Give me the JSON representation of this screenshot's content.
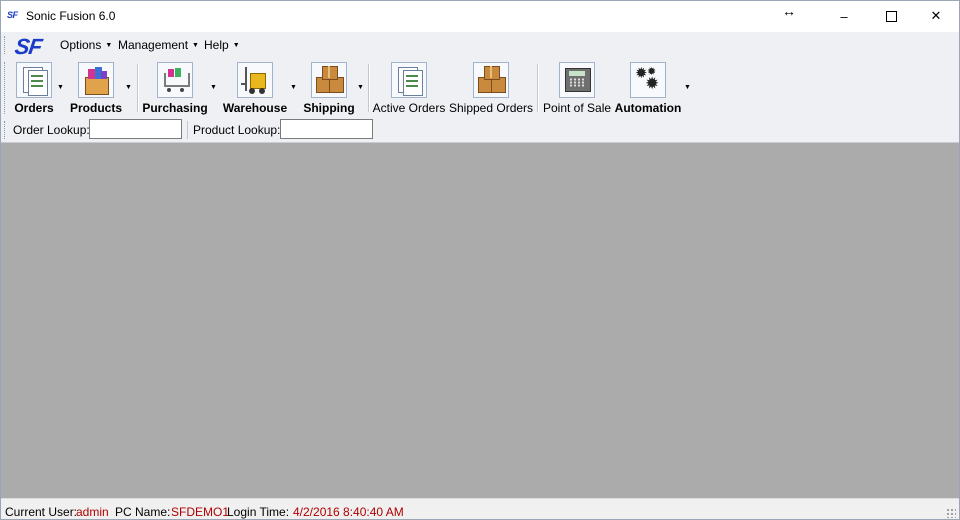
{
  "window": {
    "small_logo": "SF",
    "title": "Sonic Fusion 6.0",
    "controls": {
      "minimize": "–",
      "maximize": "",
      "close": "✕",
      "resize_hint": "↔"
    }
  },
  "menubar": {
    "logo": "SF",
    "items": [
      {
        "label": "Options",
        "caret": "▼"
      },
      {
        "label": "Management",
        "caret": "▼"
      },
      {
        "label": "Help",
        "caret": "▼"
      }
    ]
  },
  "toolbar": {
    "buttons": [
      {
        "label": "Orders",
        "icon": "orders-icon",
        "bold": true,
        "dropdown": true
      },
      {
        "label": "Products",
        "icon": "products-icon",
        "bold": true,
        "dropdown": true
      },
      {
        "label": "Purchasing",
        "icon": "shopping-cart-icon",
        "bold": true,
        "dropdown": true
      },
      {
        "label": "Warehouse",
        "icon": "forklift-icon",
        "bold": true,
        "dropdown": true
      },
      {
        "label": "Shipping",
        "icon": "boxes-icon",
        "bold": true,
        "dropdown": true
      },
      {
        "label": "Active Orders",
        "icon": "active-orders-icon",
        "bold": false,
        "dropdown": false
      },
      {
        "label": "Shipped Orders",
        "icon": "shipped-orders-icon",
        "bold": false,
        "dropdown": false
      },
      {
        "label": "Point of Sale",
        "icon": "cash-register-icon",
        "bold": false,
        "dropdown": false
      },
      {
        "label": "Automation",
        "icon": "gears-icon",
        "bold": true,
        "dropdown": true
      }
    ],
    "caret": "▼"
  },
  "lookup": {
    "order_label": "Order Lookup:",
    "order_value": "",
    "product_label": "Product Lookup:",
    "product_value": ""
  },
  "status": {
    "user_label": "Current User:",
    "user_value": "admin",
    "pc_label": "PC Name:",
    "pc_value": "SFDEMO1",
    "login_label": "Login Time:",
    "login_value": "4/2/2016 8:40:40 AM"
  },
  "colors": {
    "brand": "#1a3cc8",
    "toolbar_bg": "#eef0f4",
    "workspace": "#ababab",
    "status_value": "#b00000"
  }
}
